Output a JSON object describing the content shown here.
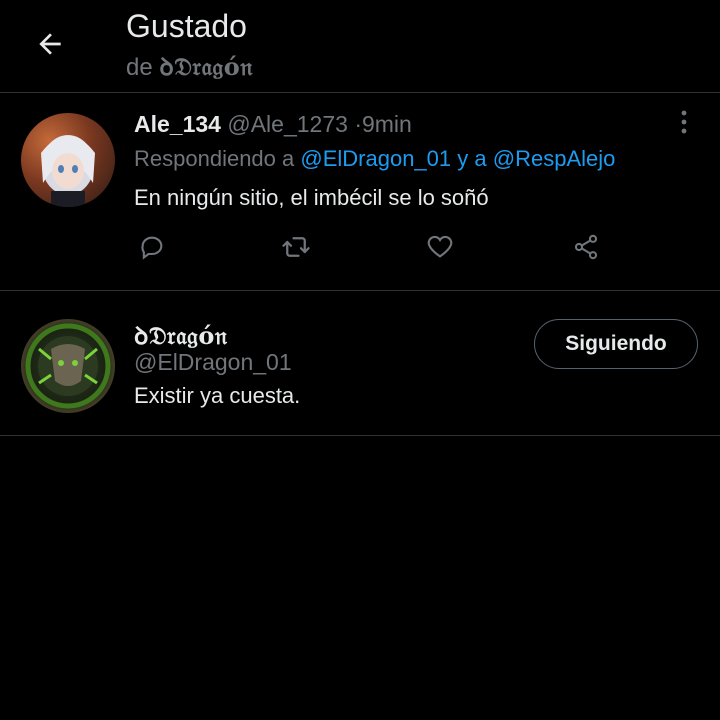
{
  "header": {
    "title": "Gustado",
    "subtitle_prefix": "de",
    "subtitle_name": "ꝺ𝔇𝔯𝔞𝔤ó𝔫"
  },
  "tweet": {
    "display_name": "Ale_134",
    "handle": "@Ale_1273",
    "separator": "·",
    "time": "9min",
    "reply_prefix": "Respondiendo a",
    "reply_mention_1": "@ElDragon_01",
    "reply_joiner": "y a",
    "reply_mention_2": "@RespAlejo",
    "text": "En ningún sitio, el imbécil se lo soñó",
    "actions": [
      "reply-icon",
      "retweet-icon",
      "heart-icon",
      "share-icon"
    ]
  },
  "liker": {
    "display_name": "ꝺ𝔇𝔯𝔞𝔤ó𝔫",
    "handle": "@ElDragon_01",
    "bio": "Existir ya cuesta.",
    "follow_label": "Siguiendo"
  },
  "colors": {
    "background": "#000000",
    "text": "#e7e9ea",
    "muted": "#71767b",
    "link": "#1d9bf0",
    "divider": "#2f3336"
  }
}
